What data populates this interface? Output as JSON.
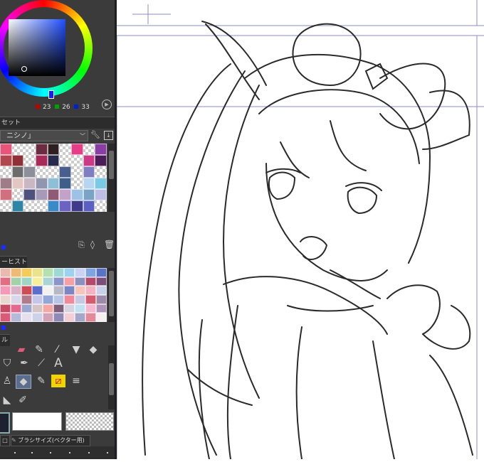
{
  "color_wheel": {
    "r": "23",
    "g": "26",
    "b": "33",
    "r_color": "#c00000",
    "g_color": "#00a000",
    "b_color": "#0020d0"
  },
  "palette": {
    "tab_label": "セット",
    "set_name": "ニシノ」",
    "swatches": [
      "#e9557a",
      "",
      "",
      "#6b2c42",
      "#2e2020",
      "",
      "#e73c87",
      "",
      "#8a3da3",
      "#b0474f",
      "#8f3037",
      "",
      "#a82b57",
      "#272a4a",
      "",
      "",
      "#cc3a86",
      "#4a1d58",
      "",
      "#6c6c6c",
      "#8d8f9a",
      "",
      "",
      "#4a5e8e",
      "",
      "#7e7ec0",
      "",
      "#9e7d88",
      "#e3c7c3",
      "#cab7c4",
      "#8f96ad",
      "#8fbfd7",
      "#3d5e8a",
      "",
      "#b6d5f2",
      "#7bc9e3",
      "#d16f7e",
      "",
      "#4f527c",
      "#a79ab8",
      "#8f5a74",
      "#c2a2c9",
      "#9ec2e6",
      "#79a4c5",
      "#bdbde6",
      "",
      "#2f85a6",
      "",
      "",
      "#3a89c9",
      "#6a63c2",
      "#3e3c88",
      "#5b5fc1",
      ""
    ]
  },
  "history": {
    "tab_label": "ーヒストリー",
    "swatches": [
      "#eab9b0",
      "#efba75",
      "#f4cd58",
      "#ebe38b",
      "#b5e0b0",
      "#9fd9d6",
      "#9cd2f0",
      "#cad3f5",
      "#7fa5e0",
      "#5a73c4",
      "#e46c80",
      "#a2d2a9",
      "#9dd5c6",
      "#f6f09c",
      "#a9d3d7",
      "#8f94c8",
      "#f5a0a4",
      "#8b90be",
      "#b4496a",
      "#7e4e7a",
      "#f29ab7",
      "#d8b2c6",
      "#cf4c57",
      "#5b6fca",
      "#f3f0f2",
      "#b8b7c6",
      "#7d86c5",
      "#f7c3bd",
      "#f4b3c0",
      "#c7d2e8",
      "#e9d7cf",
      "#d8d8e9",
      "#b17b8c",
      "#c4c7ea",
      "#95a7d6",
      "#b8c5e6",
      "#f08a9a",
      "#c6c9e1",
      "#d55c6e",
      "#9c8aa8",
      "#c64a62",
      "#e3698d",
      "#9aa7cf",
      "#d6c4c4",
      "#f7a7a3",
      "#7e5f7b",
      "#d6d3e0",
      "#c3e2f1",
      "#f7b7cf",
      "#ad94b8",
      "#d95b77",
      "#b5bad8",
      "#e6e0ee",
      "#cdd2e9",
      "#d1a3b5",
      "#8f8ab5",
      "#f3ced5",
      "#a3a7c9",
      "#e38998",
      "#f5eff2"
    ]
  },
  "tools": {
    "section_label": "ル",
    "row2": [
      "bucket-icon",
      "pen-icon",
      "blur-icon",
      "text-icon"
    ],
    "row3": [
      "fill-icon",
      "eraser-icon",
      "marker-icon",
      "decoration-icon",
      "lines-icon"
    ],
    "text_glyph": "A"
  },
  "bottom": {
    "brush_size_label": "ブラシサイズ(ベクター用)"
  }
}
